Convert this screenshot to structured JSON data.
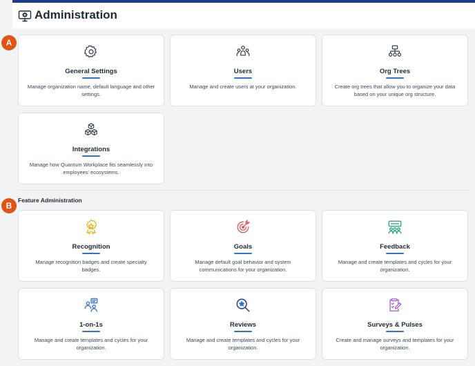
{
  "header": {
    "title": "Administration"
  },
  "callouts": {
    "a": "A",
    "b": "B"
  },
  "admin_cards": [
    {
      "title": "General Settings",
      "desc": "Manage organization name, default language and other settings.",
      "icon": "gear-icon"
    },
    {
      "title": "Users",
      "desc": "Manage and create users at your organization.",
      "icon": "users-group-icon"
    },
    {
      "title": "Org Trees",
      "desc": "Create org trees that allow you to organize your data based on your unique org structure.",
      "icon": "org-tree-icon"
    },
    {
      "title": "Integrations",
      "desc": "Manage how Quantum Workplace fits seamlessly into employees' ecosystems.",
      "icon": "cubes-icon"
    }
  ],
  "feature_section": {
    "title": "Feature Administration",
    "cards": [
      {
        "title": "Recognition",
        "desc": "Manage recognition badges and create specialty badges.",
        "icon": "award-badge-icon"
      },
      {
        "title": "Goals",
        "desc": "Manage default goal behavior and system communications for your organization.",
        "icon": "target-icon"
      },
      {
        "title": "Feedback",
        "desc": "Manage and create templates and cycles for your organization.",
        "icon": "feedback-icon"
      },
      {
        "title": "1-on-1s",
        "desc": "Manage and create templates and cycles for your organization.",
        "icon": "one-on-one-icon"
      },
      {
        "title": "Reviews",
        "desc": "Manage and create templates and cycles for your organization.",
        "icon": "review-search-icon"
      },
      {
        "title": "Surveys & Pulses",
        "desc": "Create and manage surveys and templates for your organization.",
        "icon": "survey-clipboard-icon"
      }
    ]
  },
  "colors": {
    "primary_blue": "#2f6fd6",
    "top_bar": "#1a3c8a",
    "callout_orange": "#e05312",
    "recognition": "#e2b21a",
    "goals": "#e0505a",
    "feedback": "#1fa27a",
    "surveys": "#9b59d0"
  }
}
